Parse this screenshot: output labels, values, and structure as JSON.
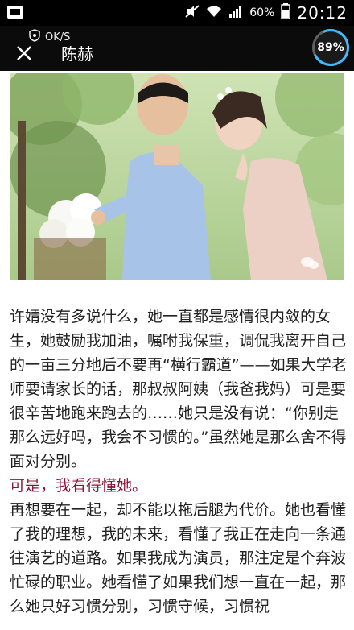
{
  "status_bar": {
    "battery": "60%",
    "time": "20:12"
  },
  "app_bar": {
    "vpn_label": "OK/S",
    "title": "陈赫",
    "badge": "89%"
  },
  "photo": {
    "icon": "wechat-icon"
  },
  "article": {
    "p1": "许婧没有多说什么，她一直都是感情很内敛的女生，她鼓励我加油，嘱咐我保重，调侃我离开自己的一亩三分地后不要再“横行霸道”——如果大学老师要请家长的话，那叔叔阿姨（我爸我妈）可是要很辛苦地跑来跑去的……她只是没有说：“你别走那么远好吗，我会不习惯的。”虽然她是那么舍不得面对分别。",
    "p2": "可是，我看得懂她。",
    "p3": "再想要在一起，却不能以拖后腿为代价。她也看懂了我的理想，我的未来，看懂了我正在走向一条通往演艺的道路。如果我成为演员，那注定是个奔波忙碌的职业。她看懂了如果我们想一直在一起，那么她只好习惯分别，习惯守候，习惯祝"
  }
}
